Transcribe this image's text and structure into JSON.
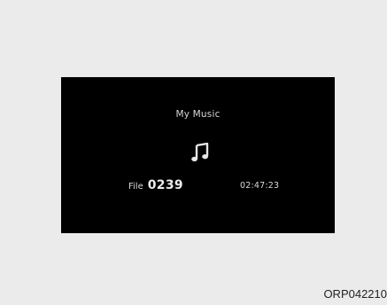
{
  "display": {
    "source_title": "My Music",
    "file_label": "File",
    "file_number": "0239",
    "play_time": "02:47:23",
    "icon": "music-note-icon"
  },
  "figure": {
    "reference_code": "ORP042210"
  },
  "colors": {
    "page_background": "#ebebeb",
    "screen_background": "#000000",
    "screen_text": "#d8d8d8"
  }
}
